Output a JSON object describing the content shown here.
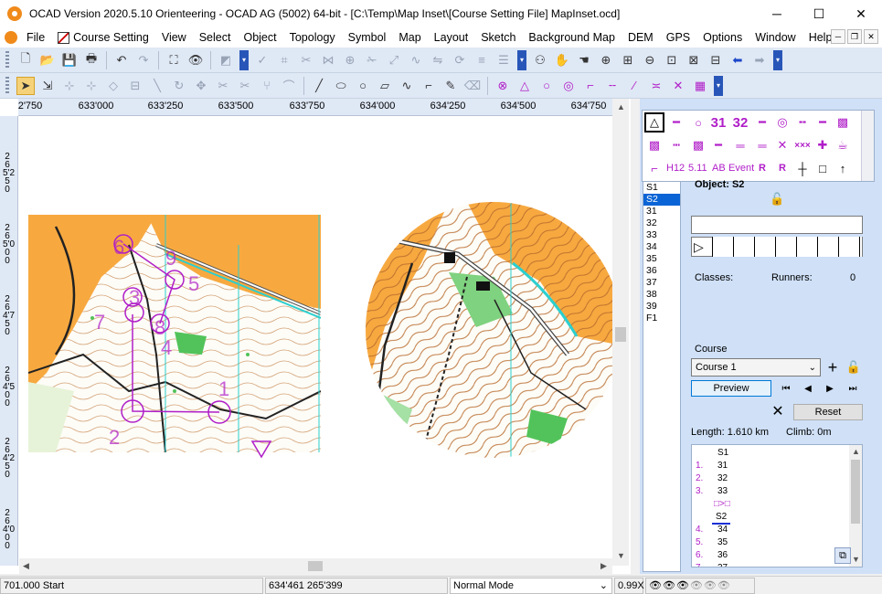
{
  "window": {
    "title": "OCAD Version 2020.5.10 Orienteering - OCAD AG (5002) 64-bit - [C:\\Temp\\Map Inset\\[Course Setting File] MapInset.ocd]",
    "min": "─",
    "max": "☐",
    "close": "✕"
  },
  "menu": {
    "items": [
      "File",
      "Course Setting",
      "View",
      "Select",
      "Object",
      "Topology",
      "Symbol",
      "Map",
      "Layout",
      "Sketch",
      "Background Map",
      "DEM",
      "GPS",
      "Options",
      "Window",
      "Help"
    ],
    "mdi_min": "─",
    "mdi_restore": "❐",
    "mdi_close": "✕"
  },
  "ruler": {
    "x_labels": [
      "2'750",
      "633'000",
      "633'250",
      "633'500",
      "633'750",
      "634'000",
      "634'250",
      "634'500",
      "634'750"
    ],
    "y_labels": [
      "265'250",
      "265'000",
      "264'750",
      "264'500",
      "264'250",
      "264'000"
    ]
  },
  "map": {
    "controls": [
      "6",
      "9",
      "5",
      "3",
      "7",
      "8",
      "4",
      "1",
      "2"
    ]
  },
  "panel": {
    "control_list": [
      "S1",
      "S2",
      "31",
      "32",
      "33",
      "34",
      "35",
      "36",
      "37",
      "38",
      "39",
      "F1"
    ],
    "selected_control": "S2",
    "symbols_row3": [
      "H12",
      "5.11",
      "AB",
      "Event"
    ],
    "object_label": "Object: S2",
    "classes_label": "Classes:",
    "runners_label": "Runners:",
    "runners_value": "0",
    "course_label": "Course",
    "course_selected": "Course 1",
    "preview_label": "Preview",
    "reset_label": "Reset",
    "length_label": "Length: 1.610 km",
    "climb_label": "Climb: 0m",
    "legs": [
      {
        "n": "",
        "c": "S1"
      },
      {
        "n": "1.",
        "c": "31"
      },
      {
        "n": "2.",
        "c": "32"
      },
      {
        "n": "3.",
        "c": "33"
      },
      {
        "n": "",
        "c": "□>□"
      },
      {
        "n": "",
        "c": "S2"
      },
      {
        "n": "4.",
        "c": "34"
      },
      {
        "n": "5.",
        "c": "35"
      },
      {
        "n": "6.",
        "c": "36"
      },
      {
        "n": "7.",
        "c": "37"
      }
    ]
  },
  "status": {
    "left": "701.000 Start",
    "coords": "634'461   265'399",
    "mode": "Normal Mode",
    "zoom": "0.99X"
  },
  "colors": {
    "course_purple": "#b01ec8",
    "open_land": "#f7a940",
    "water": "#2ccfcf",
    "green": "#52c35a",
    "selection_blue": "#0a64d6"
  }
}
